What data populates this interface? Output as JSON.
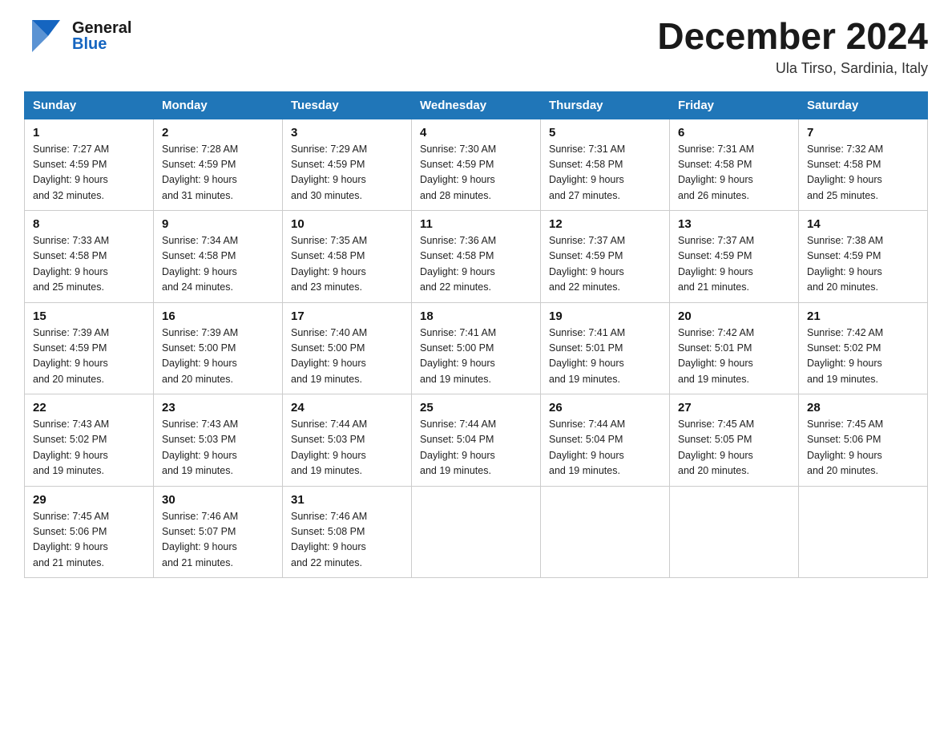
{
  "header": {
    "logo": {
      "general": "General",
      "blue": "Blue"
    },
    "month_title": "December 2024",
    "location": "Ula Tirso, Sardinia, Italy"
  },
  "weekdays": [
    "Sunday",
    "Monday",
    "Tuesday",
    "Wednesday",
    "Thursday",
    "Friday",
    "Saturday"
  ],
  "weeks": [
    [
      {
        "day": "1",
        "sunrise": "7:27 AM",
        "sunset": "4:59 PM",
        "daylight": "9 hours and 32 minutes."
      },
      {
        "day": "2",
        "sunrise": "7:28 AM",
        "sunset": "4:59 PM",
        "daylight": "9 hours and 31 minutes."
      },
      {
        "day": "3",
        "sunrise": "7:29 AM",
        "sunset": "4:59 PM",
        "daylight": "9 hours and 30 minutes."
      },
      {
        "day": "4",
        "sunrise": "7:30 AM",
        "sunset": "4:59 PM",
        "daylight": "9 hours and 28 minutes."
      },
      {
        "day": "5",
        "sunrise": "7:31 AM",
        "sunset": "4:58 PM",
        "daylight": "9 hours and 27 minutes."
      },
      {
        "day": "6",
        "sunrise": "7:31 AM",
        "sunset": "4:58 PM",
        "daylight": "9 hours and 26 minutes."
      },
      {
        "day": "7",
        "sunrise": "7:32 AM",
        "sunset": "4:58 PM",
        "daylight": "9 hours and 25 minutes."
      }
    ],
    [
      {
        "day": "8",
        "sunrise": "7:33 AM",
        "sunset": "4:58 PM",
        "daylight": "9 hours and 25 minutes."
      },
      {
        "day": "9",
        "sunrise": "7:34 AM",
        "sunset": "4:58 PM",
        "daylight": "9 hours and 24 minutes."
      },
      {
        "day": "10",
        "sunrise": "7:35 AM",
        "sunset": "4:58 PM",
        "daylight": "9 hours and 23 minutes."
      },
      {
        "day": "11",
        "sunrise": "7:36 AM",
        "sunset": "4:58 PM",
        "daylight": "9 hours and 22 minutes."
      },
      {
        "day": "12",
        "sunrise": "7:37 AM",
        "sunset": "4:59 PM",
        "daylight": "9 hours and 22 minutes."
      },
      {
        "day": "13",
        "sunrise": "7:37 AM",
        "sunset": "4:59 PM",
        "daylight": "9 hours and 21 minutes."
      },
      {
        "day": "14",
        "sunrise": "7:38 AM",
        "sunset": "4:59 PM",
        "daylight": "9 hours and 20 minutes."
      }
    ],
    [
      {
        "day": "15",
        "sunrise": "7:39 AM",
        "sunset": "4:59 PM",
        "daylight": "9 hours and 20 minutes."
      },
      {
        "day": "16",
        "sunrise": "7:39 AM",
        "sunset": "5:00 PM",
        "daylight": "9 hours and 20 minutes."
      },
      {
        "day": "17",
        "sunrise": "7:40 AM",
        "sunset": "5:00 PM",
        "daylight": "9 hours and 19 minutes."
      },
      {
        "day": "18",
        "sunrise": "7:41 AM",
        "sunset": "5:00 PM",
        "daylight": "9 hours and 19 minutes."
      },
      {
        "day": "19",
        "sunrise": "7:41 AM",
        "sunset": "5:01 PM",
        "daylight": "9 hours and 19 minutes."
      },
      {
        "day": "20",
        "sunrise": "7:42 AM",
        "sunset": "5:01 PM",
        "daylight": "9 hours and 19 minutes."
      },
      {
        "day": "21",
        "sunrise": "7:42 AM",
        "sunset": "5:02 PM",
        "daylight": "9 hours and 19 minutes."
      }
    ],
    [
      {
        "day": "22",
        "sunrise": "7:43 AM",
        "sunset": "5:02 PM",
        "daylight": "9 hours and 19 minutes."
      },
      {
        "day": "23",
        "sunrise": "7:43 AM",
        "sunset": "5:03 PM",
        "daylight": "9 hours and 19 minutes."
      },
      {
        "day": "24",
        "sunrise": "7:44 AM",
        "sunset": "5:03 PM",
        "daylight": "9 hours and 19 minutes."
      },
      {
        "day": "25",
        "sunrise": "7:44 AM",
        "sunset": "5:04 PM",
        "daylight": "9 hours and 19 minutes."
      },
      {
        "day": "26",
        "sunrise": "7:44 AM",
        "sunset": "5:04 PM",
        "daylight": "9 hours and 19 minutes."
      },
      {
        "day": "27",
        "sunrise": "7:45 AM",
        "sunset": "5:05 PM",
        "daylight": "9 hours and 20 minutes."
      },
      {
        "day": "28",
        "sunrise": "7:45 AM",
        "sunset": "5:06 PM",
        "daylight": "9 hours and 20 minutes."
      }
    ],
    [
      {
        "day": "29",
        "sunrise": "7:45 AM",
        "sunset": "5:06 PM",
        "daylight": "9 hours and 21 minutes."
      },
      {
        "day": "30",
        "sunrise": "7:46 AM",
        "sunset": "5:07 PM",
        "daylight": "9 hours and 21 minutes."
      },
      {
        "day": "31",
        "sunrise": "7:46 AM",
        "sunset": "5:08 PM",
        "daylight": "9 hours and 22 minutes."
      },
      null,
      null,
      null,
      null
    ]
  ],
  "labels": {
    "sunrise": "Sunrise:",
    "sunset": "Sunset:",
    "daylight": "Daylight:"
  }
}
